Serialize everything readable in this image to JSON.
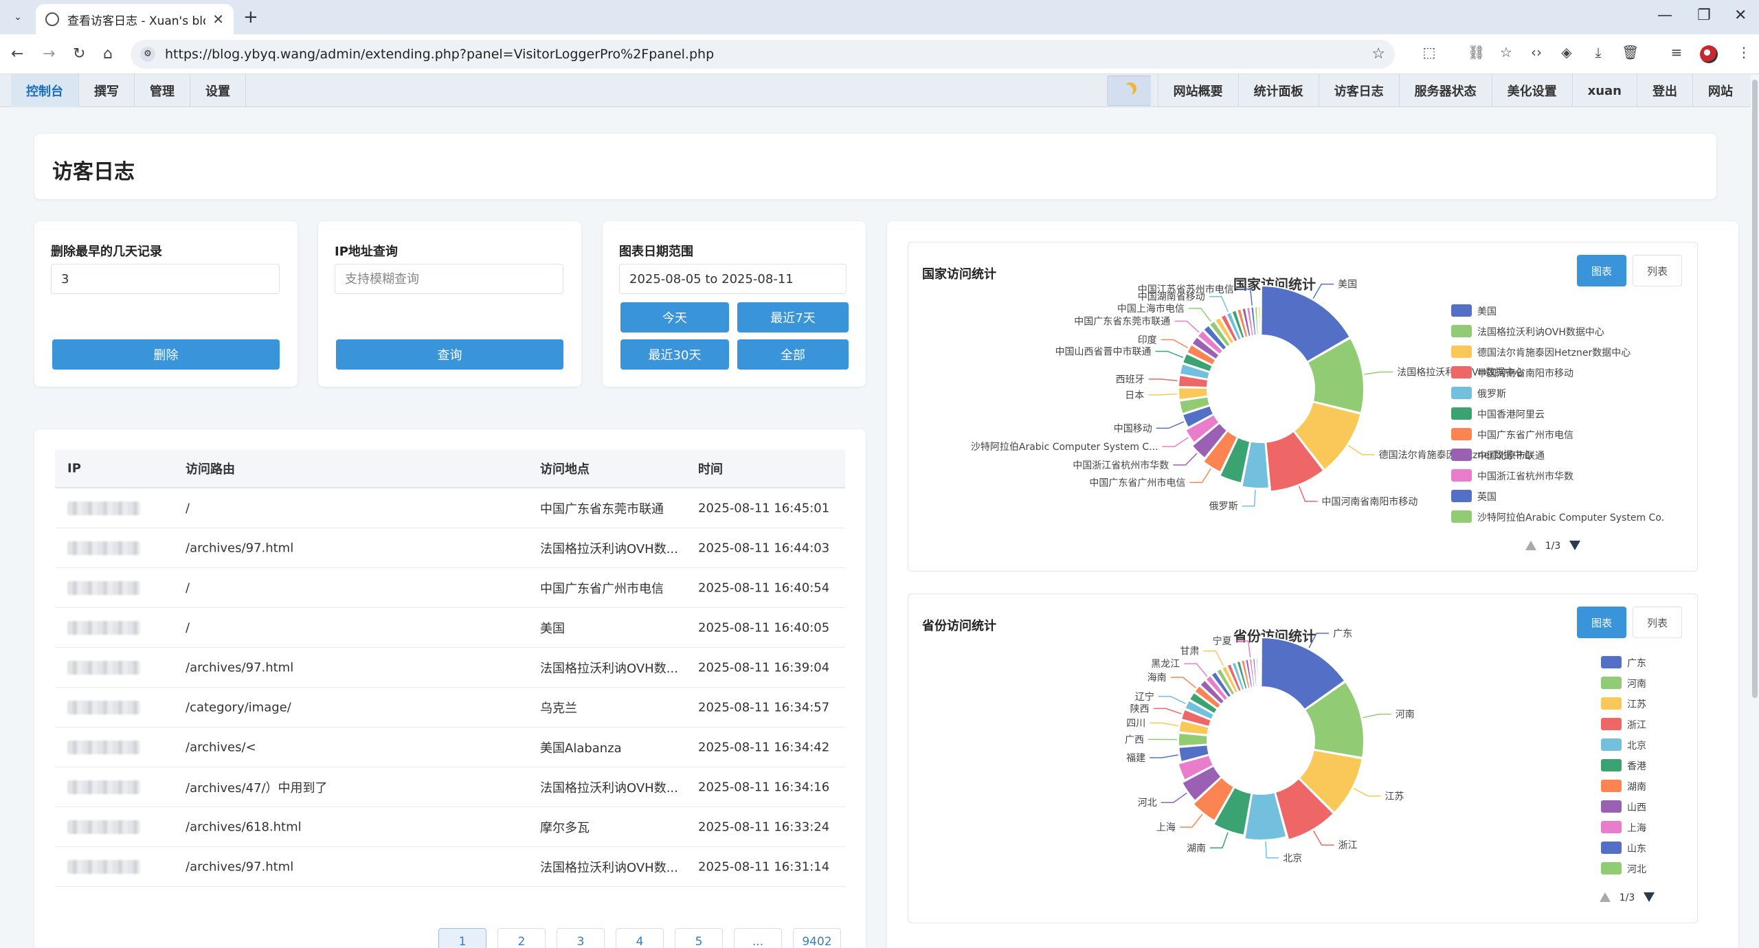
{
  "browser": {
    "tab_title": "查看访客日志 - Xuan's blog - ",
    "url": "https://blog.ybyq.wang/admin/extending.php?panel=VisitorLoggerPro%2Fpanel.php"
  },
  "nav": {
    "left": [
      "控制台",
      "撰写",
      "管理",
      "设置"
    ],
    "right": [
      "网站概要",
      "统计面板",
      "访客日志",
      "服务器状态",
      "美化设置",
      "xuan",
      "登出",
      "网站"
    ]
  },
  "page_title": "访客日志",
  "controls": {
    "delete": {
      "label": "删除最早的几天记录",
      "value": "3",
      "button": "删除"
    },
    "ip": {
      "label": "IP地址查询",
      "placeholder": "支持模糊查询",
      "button": "查询"
    },
    "range": {
      "label": "图表日期范围",
      "value": "2025-08-05 to 2025-08-11",
      "buttons": [
        "今天",
        "最近7天",
        "最近30天",
        "全部"
      ]
    }
  },
  "table": {
    "headers": [
      "IP",
      "访问路由",
      "访问地点",
      "时间"
    ],
    "rows": [
      {
        "route": "/",
        "location": "中国广东省东莞市联通",
        "time": "2025-08-11 16:45:01"
      },
      {
        "route": "/archives/97.html",
        "location": "法国格拉沃利讷OVH数...",
        "time": "2025-08-11 16:44:03"
      },
      {
        "route": "/",
        "location": "中国广东省广州市电信",
        "time": "2025-08-11 16:40:54"
      },
      {
        "route": "/",
        "location": "美国",
        "time": "2025-08-11 16:40:05"
      },
      {
        "route": "/archives/97.html",
        "location": "法国格拉沃利讷OVH数...",
        "time": "2025-08-11 16:39:04"
      },
      {
        "route": "/category/image/",
        "location": "乌克兰",
        "time": "2025-08-11 16:34:57"
      },
      {
        "route": "/archives/<",
        "location": "美国Alabanza",
        "time": "2025-08-11 16:34:42"
      },
      {
        "route": "/archives/47/）中用到了",
        "location": "法国格拉沃利讷OVH数...",
        "time": "2025-08-11 16:34:16"
      },
      {
        "route": "/archives/618.html",
        "location": "摩尔多瓦",
        "time": "2025-08-11 16:33:24"
      },
      {
        "route": "/archives/97.html",
        "location": "法国格拉沃利讷OVH数...",
        "time": "2025-08-11 16:31:14"
      }
    ]
  },
  "pagination": [
    "1",
    "2",
    "3",
    "4",
    "5",
    "...",
    "9402"
  ],
  "country_chart": {
    "panel_title": "国家访问统计",
    "toggle": [
      "图表",
      "列表"
    ],
    "legend_page": "1/3"
  },
  "province_chart": {
    "panel_title": "省份访问统计",
    "toggle": [
      "图表",
      "列表"
    ],
    "legend_page": "1/3"
  },
  "chart_data": [
    {
      "type": "pie",
      "title": "国家访问统计",
      "values": [
        11,
        8,
        7,
        6,
        3,
        2.6,
        2.4,
        2.2,
        2,
        1.9,
        1.8,
        1.7,
        1.6,
        1.5,
        1.4,
        1.3,
        1.2,
        1.1,
        1,
        0.9,
        0.85,
        0.8,
        0.75,
        0.7,
        0.65,
        0.6,
        0.55,
        0.5,
        0.45,
        0.4
      ],
      "slice_labels": [
        {
          "index": 0,
          "text": "美国"
        },
        {
          "index": 1,
          "text": "法国格拉沃利讷OVH数据中心"
        },
        {
          "index": 2,
          "text": "德国法尔肯施泰因Hetzner数据中心"
        },
        {
          "index": 3,
          "text": "中国河南省南阳市移动"
        },
        {
          "index": 4,
          "text": "俄罗斯"
        },
        {
          "index": 6,
          "text": "中国广东省广州市电信"
        },
        {
          "index": 7,
          "text": "中国浙江省杭州市华数"
        },
        {
          "index": 8,
          "text": "沙特阿拉伯Arabic Computer System C..."
        },
        {
          "index": 9,
          "text": "中国移动"
        },
        {
          "index": 11,
          "text": "日本"
        },
        {
          "index": 12,
          "text": "西班牙"
        },
        {
          "index": 14,
          "text": "中国山西省晋中市联通"
        },
        {
          "index": 15,
          "text": "印度"
        },
        {
          "index": 17,
          "text": "中国广东省东莞市联通"
        },
        {
          "index": 19,
          "text": "中国上海市电信"
        },
        {
          "index": 22,
          "text": "中国湖南省移动"
        },
        {
          "index": 27,
          "text": "中国江苏省苏州市电信"
        }
      ],
      "legend": [
        "美国",
        "法国格拉沃利讷OVH数据中心",
        "德国法尔肯施泰因Hetzner数据中心",
        "中国河南省南阳市移动",
        "俄罗斯",
        "中国香港阿里云",
        "中国广东省广州市电信",
        "中国北京市联通",
        "中国浙江省杭州市华数",
        "英国",
        "沙特阿拉伯Arabic Computer System Co."
      ],
      "legend_position": "right"
    },
    {
      "type": "pie",
      "title": "省份访问统计",
      "values": [
        11,
        9,
        7,
        6,
        5,
        4,
        3.5,
        3,
        2.5,
        2.2,
        2,
        1.8,
        1.6,
        1.4,
        1.3,
        1.2,
        1.1,
        1,
        0.9,
        0.85,
        0.8,
        0.75,
        0.7,
        0.65,
        0.6,
        0.55,
        0.5,
        0.45,
        0.4,
        0.35
      ],
      "slice_labels": [
        {
          "index": 0,
          "text": "广东"
        },
        {
          "index": 1,
          "text": "河南"
        },
        {
          "index": 2,
          "text": "江苏"
        },
        {
          "index": 3,
          "text": "浙江"
        },
        {
          "index": 4,
          "text": "北京"
        },
        {
          "index": 5,
          "text": "湖南"
        },
        {
          "index": 6,
          "text": "上海"
        },
        {
          "index": 7,
          "text": "河北"
        },
        {
          "index": 9,
          "text": "福建"
        },
        {
          "index": 10,
          "text": "广西"
        },
        {
          "index": 11,
          "text": "四川"
        },
        {
          "index": 12,
          "text": "陕西"
        },
        {
          "index": 13,
          "text": "辽宁"
        },
        {
          "index": 15,
          "text": "海南"
        },
        {
          "index": 17,
          "text": "黑龙江"
        },
        {
          "index": 20,
          "text": "甘肃"
        },
        {
          "index": 26,
          "text": "宁夏"
        }
      ],
      "legend": [
        "广东",
        "河南",
        "江苏",
        "浙江",
        "北京",
        "香港",
        "湖南",
        "山西",
        "上海",
        "山东",
        "河北"
      ],
      "legend_position": "right"
    }
  ],
  "colors": {
    "accent": "#3a94d9",
    "palette": [
      "#5470c6",
      "#91cc75",
      "#fac858",
      "#ee6666",
      "#73c0de",
      "#3ba272",
      "#fc8452",
      "#9a60b4",
      "#ea7ccc"
    ]
  }
}
